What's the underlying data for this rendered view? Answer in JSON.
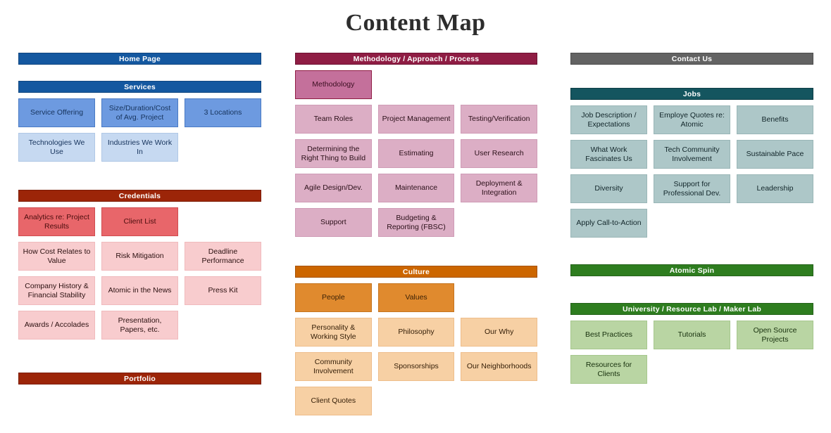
{
  "title": "Content Map",
  "colors": {
    "blue_header": "#1458a0",
    "blue_primary": "#6d9ae0",
    "blue_secondary": "#c6d9f1",
    "blue_text": "#1f3864",
    "red_header": "#9c2508",
    "red_primary": "#e8666a",
    "red_secondary": "#f8ccce",
    "maroon_header": "#8f1d44",
    "maroon_primary": "#c4709b",
    "maroon_secondary": "#dcaec5",
    "orange_header": "#cc6600",
    "orange_primary": "#e08a2e",
    "orange_secondary": "#f7d0a4",
    "gray_header": "#636363",
    "teal_header": "#14555f",
    "teal_primary": "#adc7c8",
    "green_header": "#2e7d1f",
    "green_primary": "#b9d5a3"
  },
  "columns": [
    {
      "id": "left",
      "sections": [
        {
          "id": "home-page",
          "header": "Home Page",
          "header_color": "#1458a0",
          "border_color": "#0f4680",
          "rows": []
        },
        {
          "id": "services",
          "header": "Services",
          "header_color": "#1458a0",
          "border_color": "#0f4680",
          "rows": [
            [
              {
                "label": "Service Offering",
                "bg": "#6d9ae0",
                "border": "#4a7ac4",
                "color": "#16335c"
              },
              {
                "label": "Size/Duration/Cost of Avg. Project",
                "bg": "#6d9ae0",
                "border": "#4a7ac4",
                "color": "#16335c"
              },
              {
                "label": "3 Locations",
                "bg": "#6d9ae0",
                "border": "#4a7ac4",
                "color": "#16335c"
              }
            ],
            [
              {
                "label": "Technologies We Use",
                "bg": "#c6d9f1",
                "border": "#b0c8e6",
                "color": "#16335c"
              },
              {
                "label": "Industries We Work In",
                "bg": "#c6d9f1",
                "border": "#b0c8e6",
                "color": "#16335c"
              },
              {
                "label": "",
                "empty": true
              }
            ]
          ]
        },
        {
          "id": "credentials",
          "header": "Credentials",
          "header_color": "#9c2508",
          "border_color": "#7c1d06",
          "rows": [
            [
              {
                "label": "Analytics re: Project Results",
                "bg": "#e8666a",
                "border": "#cf4c50",
                "color": "#4a0d0d"
              },
              {
                "label": "Client List",
                "bg": "#e8666a",
                "border": "#cf4c50",
                "color": "#4a0d0d"
              },
              {
                "label": "",
                "empty": true
              }
            ],
            [
              {
                "label": "How Cost Relates to Value",
                "bg": "#f8ccce",
                "border": "#f0babd",
                "color": "#2b1010"
              },
              {
                "label": "Risk Mitigation",
                "bg": "#f8ccce",
                "border": "#f0babd",
                "color": "#2b1010"
              },
              {
                "label": "Deadline Performance",
                "bg": "#f8ccce",
                "border": "#f0babd",
                "color": "#2b1010"
              }
            ],
            [
              {
                "label": "Company History & Financial Stability",
                "bg": "#f8ccce",
                "border": "#f0babd",
                "color": "#2b1010"
              },
              {
                "label": "Atomic in the News",
                "bg": "#f8ccce",
                "border": "#f0babd",
                "color": "#2b1010"
              },
              {
                "label": "Press Kit",
                "bg": "#f8ccce",
                "border": "#f0babd",
                "color": "#2b1010"
              }
            ],
            [
              {
                "label": "Awards / Accolades",
                "bg": "#f8ccce",
                "border": "#f0babd",
                "color": "#2b1010"
              },
              {
                "label": "Presentation, Papers, etc.",
                "bg": "#f8ccce",
                "border": "#f0babd",
                "color": "#2b1010"
              },
              {
                "label": "",
                "empty": true
              }
            ]
          ]
        },
        {
          "id": "portfolio",
          "header": "Portfolio",
          "header_color": "#9c2508",
          "border_color": "#7c1d06",
          "rows": []
        }
      ]
    },
    {
      "id": "middle",
      "sections": [
        {
          "id": "methodology-approach-process",
          "header": "Methodology / Approach / Process",
          "header_color": "#8f1d44",
          "border_color": "#6e1233",
          "rows": [
            [
              {
                "label": "Methodology",
                "bg": "#c4709b",
                "border": "#8f1d44",
                "color": "#3c0f22"
              },
              {
                "label": "",
                "empty": true
              },
              {
                "label": "",
                "empty": true
              }
            ],
            [
              {
                "label": "Team Roles",
                "bg": "#dcaec5",
                "border": "#cf9bb6",
                "color": "#2b1019"
              },
              {
                "label": "Project Management",
                "bg": "#dcaec5",
                "border": "#cf9bb6",
                "color": "#2b1019"
              },
              {
                "label": "Testing/Verification",
                "bg": "#dcaec5",
                "border": "#cf9bb6",
                "color": "#2b1019"
              }
            ],
            [
              {
                "label": "Determining the Right Thing to Build",
                "bg": "#dcaec5",
                "border": "#cf9bb6",
                "color": "#2b1019"
              },
              {
                "label": "Estimating",
                "bg": "#dcaec5",
                "border": "#cf9bb6",
                "color": "#2b1019"
              },
              {
                "label": "User Research",
                "bg": "#dcaec5",
                "border": "#cf9bb6",
                "color": "#2b1019"
              }
            ],
            [
              {
                "label": "Agile Design/Dev.",
                "bg": "#dcaec5",
                "border": "#cf9bb6",
                "color": "#2b1019"
              },
              {
                "label": "Maintenance",
                "bg": "#dcaec5",
                "border": "#cf9bb6",
                "color": "#2b1019"
              },
              {
                "label": "Deployment & Integration",
                "bg": "#dcaec5",
                "border": "#cf9bb6",
                "color": "#2b1019"
              }
            ],
            [
              {
                "label": "Support",
                "bg": "#dcaec5",
                "border": "#cf9bb6",
                "color": "#2b1019"
              },
              {
                "label": "Budgeting & Reporting (FBSC)",
                "bg": "#dcaec5",
                "border": "#cf9bb6",
                "color": "#2b1019"
              },
              {
                "label": "",
                "empty": true
              }
            ]
          ]
        },
        {
          "id": "culture",
          "header": "Culture",
          "header_color": "#cc6600",
          "border_color": "#a65200",
          "rows": [
            [
              {
                "label": "People",
                "bg": "#e08a2e",
                "border": "#c4741f",
                "color": "#3d2206"
              },
              {
                "label": "Values",
                "bg": "#e08a2e",
                "border": "#c4741f",
                "color": "#3d2206"
              },
              {
                "label": "",
                "empty": true
              }
            ],
            [
              {
                "label": "Personality & Working Style",
                "bg": "#f7d0a4",
                "border": "#eebd8a",
                "color": "#331d06"
              },
              {
                "label": "Philosophy",
                "bg": "#f7d0a4",
                "border": "#eebd8a",
                "color": "#331d06"
              },
              {
                "label": "Our Why",
                "bg": "#f7d0a4",
                "border": "#eebd8a",
                "color": "#331d06"
              }
            ],
            [
              {
                "label": "Community Involvement",
                "bg": "#f7d0a4",
                "border": "#eebd8a",
                "color": "#331d06"
              },
              {
                "label": "Sponsorships",
                "bg": "#f7d0a4",
                "border": "#eebd8a",
                "color": "#331d06"
              },
              {
                "label": "Our Neighborhoods",
                "bg": "#f7d0a4",
                "border": "#eebd8a",
                "color": "#331d06"
              }
            ],
            [
              {
                "label": "Client Quotes",
                "bg": "#f7d0a4",
                "border": "#eebd8a",
                "color": "#331d06"
              },
              {
                "label": "",
                "empty": true
              },
              {
                "label": "",
                "empty": true
              }
            ]
          ]
        }
      ]
    },
    {
      "id": "right",
      "sections": [
        {
          "id": "contact-us",
          "header": "Contact Us",
          "header_color": "#636363",
          "border_color": "#4c4c4c",
          "rows": []
        },
        {
          "id": "jobs",
          "header": "Jobs",
          "header_color": "#14555f",
          "border_color": "#0d3d45",
          "rows": [
            [
              {
                "label": "Job Description / Expectations",
                "bg": "#adc7c8",
                "border": "#9ab6b7",
                "color": "#12262a"
              },
              {
                "label": "Employe Quotes re: Atomic",
                "bg": "#adc7c8",
                "border": "#9ab6b7",
                "color": "#12262a"
              },
              {
                "label": "Benefits",
                "bg": "#adc7c8",
                "border": "#9ab6b7",
                "color": "#12262a"
              }
            ],
            [
              {
                "label": "What Work Fascinates Us",
                "bg": "#adc7c8",
                "border": "#9ab6b7",
                "color": "#12262a"
              },
              {
                "label": "Tech Community Involvement",
                "bg": "#adc7c8",
                "border": "#9ab6b7",
                "color": "#12262a"
              },
              {
                "label": "Sustainable Pace",
                "bg": "#adc7c8",
                "border": "#9ab6b7",
                "color": "#12262a"
              }
            ],
            [
              {
                "label": "Diversity",
                "bg": "#adc7c8",
                "border": "#9ab6b7",
                "color": "#12262a"
              },
              {
                "label": "Support for Professional Dev.",
                "bg": "#adc7c8",
                "border": "#9ab6b7",
                "color": "#12262a"
              },
              {
                "label": "Leadership",
                "bg": "#adc7c8",
                "border": "#9ab6b7",
                "color": "#12262a"
              }
            ],
            [
              {
                "label": "Apply Call-to-Action",
                "bg": "#adc7c8",
                "border": "#9ab6b7",
                "color": "#12262a"
              },
              {
                "label": "",
                "empty": true
              },
              {
                "label": "",
                "empty": true
              }
            ]
          ]
        },
        {
          "id": "atomic-spin",
          "header": "Atomic Spin",
          "header_color": "#2e7d1f",
          "border_color": "#24621a",
          "rows": []
        },
        {
          "id": "university-resource-lab-maker-lab",
          "header": "University / Resource Lab / Maker Lab",
          "header_color": "#2e7d1f",
          "border_color": "#24621a",
          "rows": [
            [
              {
                "label": "Best Practices",
                "bg": "#b9d5a3",
                "border": "#a6c78d",
                "color": "#17300d"
              },
              {
                "label": "Tutorials",
                "bg": "#b9d5a3",
                "border": "#a6c78d",
                "color": "#17300d"
              },
              {
                "label": "Open Source Projects",
                "bg": "#b9d5a3",
                "border": "#a6c78d",
                "color": "#17300d"
              }
            ],
            [
              {
                "label": "Resources for Clients",
                "bg": "#b9d5a3",
                "border": "#a6c78d",
                "color": "#17300d"
              },
              {
                "label": "",
                "empty": true
              },
              {
                "label": "",
                "empty": true
              }
            ]
          ]
        }
      ]
    }
  ]
}
